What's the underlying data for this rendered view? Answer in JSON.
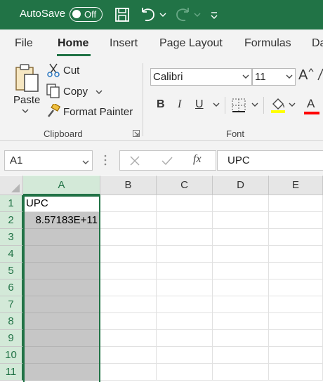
{
  "titlebar": {
    "autosave_label": "AutoSave",
    "autosave_state": "Off",
    "icons": [
      "save-icon",
      "undo-icon",
      "redo-icon",
      "customize-qat-icon"
    ]
  },
  "tabs": [
    "File",
    "Home",
    "Insert",
    "Page Layout",
    "Formulas",
    "Da"
  ],
  "active_tab": "Home",
  "clipboard": {
    "paste_label": "Paste",
    "cut_label": "Cut",
    "copy_label": "Copy",
    "format_painter_label": "Format Painter",
    "group_label": "Clipboard"
  },
  "font": {
    "font_name": "Calibri",
    "font_size": "11",
    "group_label": "Font",
    "bold": "B",
    "italic": "I",
    "underline": "U",
    "grow_font": "A",
    "font_color_letter": "A"
  },
  "formula_bar": {
    "name_box": "A1",
    "fx_label": "fx",
    "formula": "UPC"
  },
  "grid": {
    "columns": [
      "A",
      "B",
      "C",
      "D",
      "E"
    ],
    "rows": [
      "1",
      "2",
      "3",
      "4",
      "5",
      "6",
      "7",
      "8",
      "9",
      "10",
      "11"
    ],
    "cells": {
      "A1": "UPC",
      "A2": "8.57183E+11"
    }
  },
  "colors": {
    "accent": "#217346",
    "selection": "#c6c6c6",
    "highlight_bar": "#ffff00",
    "font_color_bar": "#ff0000"
  }
}
